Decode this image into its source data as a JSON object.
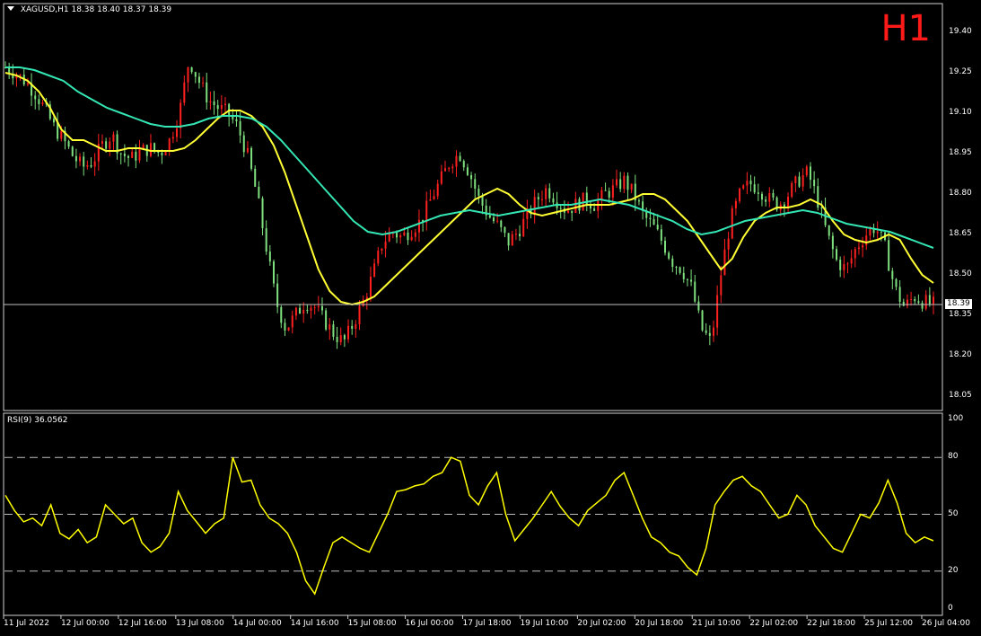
{
  "header": {
    "symbol": "XAGUSD,H1",
    "ohlc": "18.38 18.40 18.37 18.39"
  },
  "timeframe_badge": "H1",
  "rsi_header": {
    "label": "RSI(9) 36.0562"
  },
  "price_label": "18.39",
  "colors": {
    "background": "#000000",
    "bull": "#ff2020",
    "bear": "#7ee07e",
    "ma_fast": "#ffff33",
    "ma_slow": "#33e6b3",
    "rsi": "#ffff00",
    "badge": "#ff1a1a"
  },
  "chart_data": [
    {
      "type": "candlestick",
      "title": "XAGUSD,H1",
      "ylim": [
        18.0,
        19.5
      ],
      "yticks": [
        "19.40",
        "19.25",
        "19.10",
        "18.95",
        "18.80",
        "18.65",
        "18.50",
        "18.35",
        "18.20",
        "18.05"
      ],
      "ytick_values": [
        19.4,
        19.25,
        19.1,
        18.95,
        18.8,
        18.65,
        18.5,
        18.35,
        18.2,
        18.05
      ],
      "xticks": [
        "11 Jul 2022",
        "12 Jul 00:00",
        "12 Jul 16:00",
        "13 Jul 08:00",
        "14 Jul 00:00",
        "14 Jul 16:00",
        "15 Jul 08:00",
        "16 Jul 00:00",
        "17 Jul 18:00",
        "19 Jul 10:00",
        "20 Jul 02:00",
        "20 Jul 18:00",
        "21 Jul 10:00",
        "22 Jul 02:00",
        "22 Jul 18:00",
        "25 Jul 12:00",
        "26 Jul 04:00"
      ],
      "close_path": [
        19.27,
        19.25,
        19.22,
        19.18,
        19.12,
        19.05,
        19.0,
        18.94,
        18.9,
        18.92,
        18.98,
        19.02,
        18.95,
        18.93,
        18.96,
        18.97,
        18.95,
        19.0,
        19.1,
        19.3,
        19.22,
        19.15,
        19.12,
        19.1,
        19.05,
        18.95,
        18.8,
        18.6,
        18.4,
        18.3,
        18.35,
        18.4,
        18.38,
        18.33,
        18.28,
        18.25,
        18.32,
        18.4,
        18.5,
        18.62,
        18.66,
        18.64,
        18.67,
        18.7,
        18.78,
        18.85,
        18.92,
        18.95,
        18.88,
        18.78,
        18.72,
        18.68,
        18.62,
        18.66,
        18.72,
        18.78,
        18.82,
        18.78,
        18.74,
        18.76,
        18.78,
        18.76,
        18.8,
        18.82,
        18.85,
        18.8,
        18.72,
        18.68,
        18.62,
        18.55,
        18.52,
        18.45,
        18.3,
        18.25,
        18.5,
        18.7,
        18.8,
        18.84,
        18.82,
        18.78,
        18.76,
        18.8,
        18.85,
        18.88,
        18.78,
        18.65,
        18.55,
        18.52,
        18.6,
        18.65,
        18.68,
        18.6,
        18.45,
        18.38,
        18.42,
        18.4,
        18.39
      ],
      "series": [
        {
          "name": "",
          "kind": "ma_fast",
          "values": [
            19.25,
            19.24,
            19.22,
            19.18,
            19.12,
            19.04,
            19.0,
            19.0,
            18.98,
            18.96,
            18.96,
            18.97,
            18.97,
            18.96,
            18.96,
            18.96,
            18.97,
            19.0,
            19.04,
            19.08,
            19.11,
            19.11,
            19.09,
            19.05,
            18.98,
            18.88,
            18.76,
            18.64,
            18.52,
            18.44,
            18.4,
            18.39,
            18.4,
            18.42,
            18.46,
            18.5,
            18.54,
            18.58,
            18.62,
            18.66,
            18.7,
            18.74,
            18.78,
            18.8,
            18.82,
            18.8,
            18.76,
            18.73,
            18.72,
            18.73,
            18.74,
            18.75,
            18.76,
            18.76,
            18.76,
            18.77,
            18.78,
            18.8,
            18.8,
            18.78,
            18.74,
            18.7,
            18.64,
            18.58,
            18.52,
            18.56,
            18.64,
            18.7,
            18.73,
            18.75,
            18.75,
            18.76,
            18.78,
            18.76,
            18.7,
            18.65,
            18.63,
            18.62,
            18.63,
            18.65,
            18.63,
            18.56,
            18.5,
            18.47
          ]
        },
        {
          "name": "",
          "kind": "ma_slow",
          "values": [
            19.27,
            19.27,
            19.26,
            19.24,
            19.22,
            19.18,
            19.15,
            19.12,
            19.1,
            19.08,
            19.06,
            19.05,
            19.05,
            19.06,
            19.08,
            19.09,
            19.09,
            19.08,
            19.05,
            19.0,
            18.94,
            18.88,
            18.82,
            18.76,
            18.7,
            18.66,
            18.65,
            18.66,
            18.68,
            18.7,
            18.72,
            18.73,
            18.74,
            18.73,
            18.72,
            18.73,
            18.74,
            18.75,
            18.76,
            18.76,
            18.77,
            18.78,
            18.77,
            18.76,
            18.74,
            18.72,
            18.7,
            18.67,
            18.65,
            18.66,
            18.68,
            18.7,
            18.71,
            18.72,
            18.73,
            18.74,
            18.73,
            18.71,
            18.69,
            18.68,
            18.67,
            18.66,
            18.64,
            18.62,
            18.6
          ]
        }
      ]
    },
    {
      "type": "line",
      "title": "RSI(9) 36.0562",
      "ylim": [
        0,
        100
      ],
      "yticks": [
        "100",
        "80",
        "50",
        "20",
        "0"
      ],
      "ytick_values": [
        100,
        80,
        50,
        20,
        0
      ],
      "levels": [
        80,
        50,
        20
      ],
      "series": [
        {
          "name": "",
          "values": [
            60,
            52,
            46,
            48,
            44,
            55,
            40,
            37,
            42,
            35,
            38,
            55,
            50,
            45,
            48,
            35,
            30,
            33,
            40,
            62,
            52,
            46,
            40,
            45,
            48,
            80,
            67,
            68,
            55,
            48,
            45,
            40,
            30,
            15,
            8,
            22,
            35,
            38,
            35,
            32,
            30,
            40,
            50,
            62,
            63,
            65,
            66,
            70,
            72,
            80,
            78,
            60,
            55,
            65,
            72,
            50,
            36,
            42,
            48,
            55,
            62,
            54,
            48,
            44,
            52,
            56,
            60,
            68,
            72,
            60,
            48,
            38,
            35,
            30,
            28,
            22,
            18,
            32,
            55,
            62,
            68,
            70,
            65,
            62,
            55,
            48,
            50,
            60,
            55,
            44,
            38,
            32,
            30,
            40,
            50,
            48,
            56,
            68,
            56,
            40,
            35,
            38,
            36
          ]
        }
      ]
    }
  ]
}
